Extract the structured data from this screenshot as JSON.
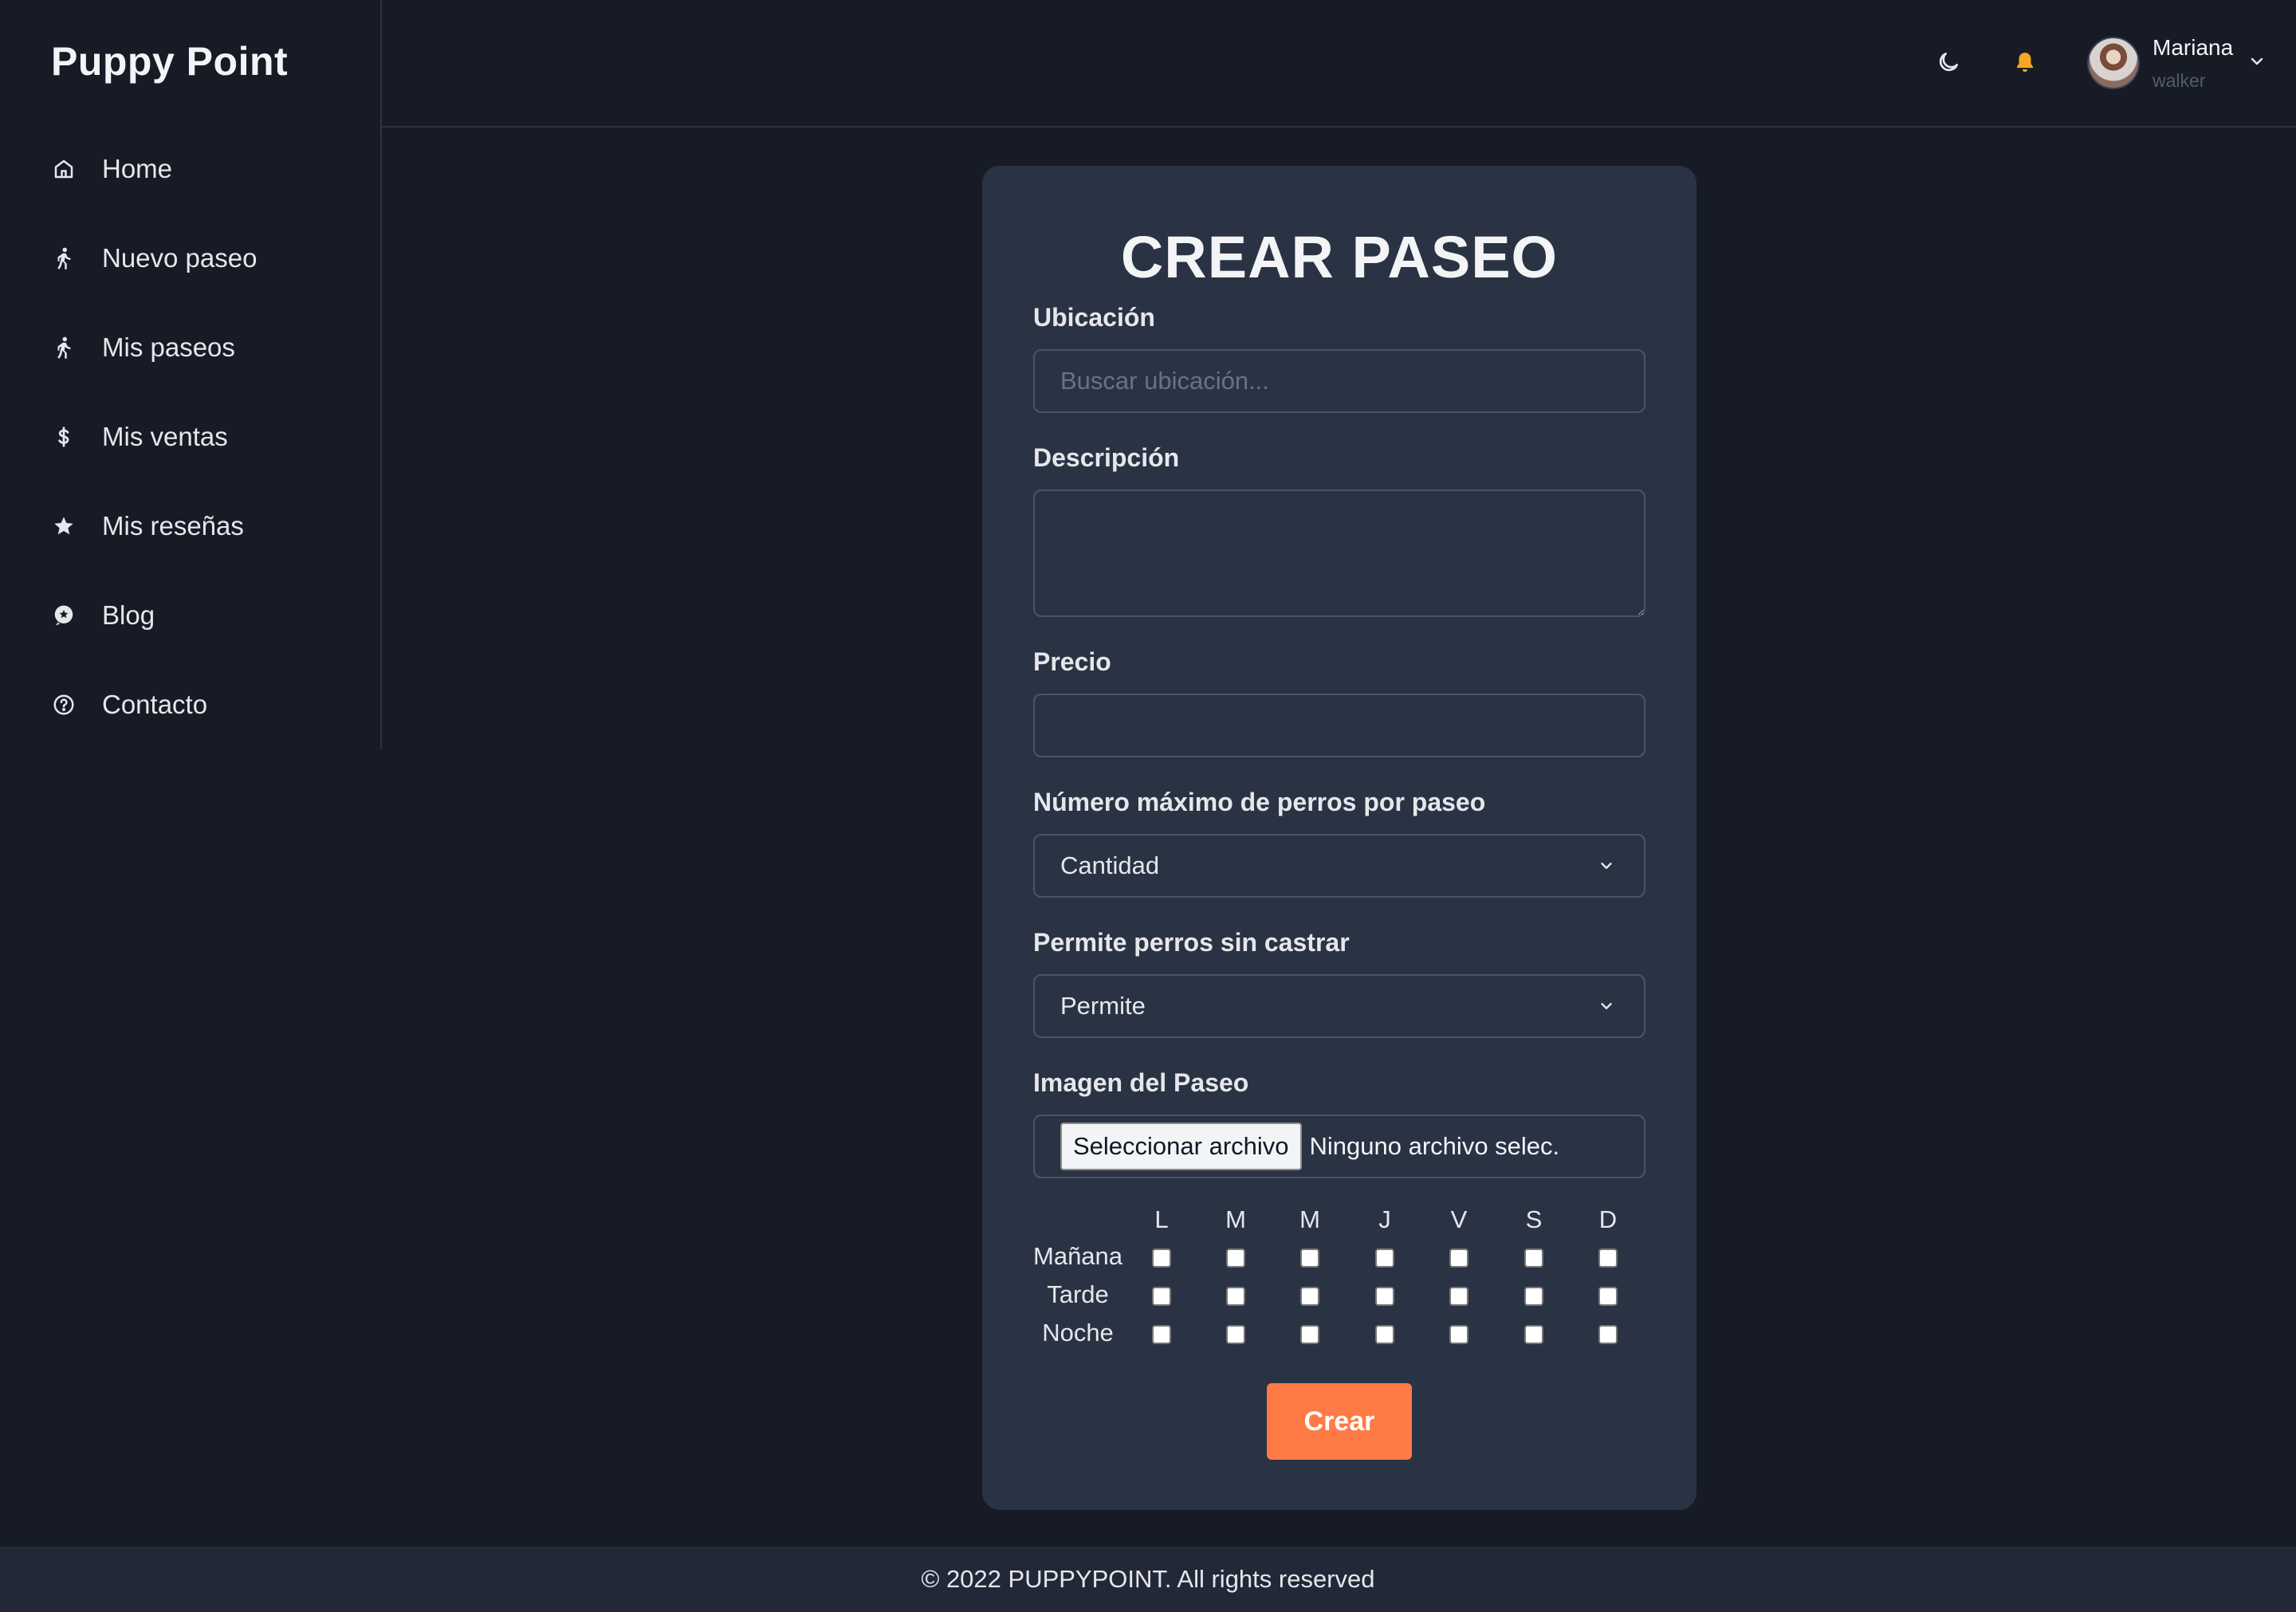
{
  "brand": "Puppy Point",
  "sidebar": {
    "items": [
      {
        "label": "Home",
        "icon": "home-icon"
      },
      {
        "label": "Nuevo paseo",
        "icon": "walking-icon"
      },
      {
        "label": "Mis paseos",
        "icon": "walking-icon"
      },
      {
        "label": "Mis ventas",
        "icon": "dollar-icon"
      },
      {
        "label": "Mis reseñas",
        "icon": "star-icon"
      },
      {
        "label": "Blog",
        "icon": "blog-icon"
      },
      {
        "label": "Contacto",
        "icon": "help-circle-icon"
      }
    ]
  },
  "header": {
    "theme_icon": "moon-icon",
    "notifications_icon": "bell-icon",
    "bell_color": "#f5a623",
    "user": {
      "name": "Mariana",
      "role": "walker"
    }
  },
  "form": {
    "title": "CREAR PASEO",
    "location": {
      "label": "Ubicación",
      "placeholder": "Buscar ubicación...",
      "value": ""
    },
    "description": {
      "label": "Descripción",
      "value": ""
    },
    "price": {
      "label": "Precio",
      "value": ""
    },
    "max_dogs": {
      "label": "Número máximo de perros por paseo",
      "selected": "Cantidad"
    },
    "uncastrated": {
      "label": "Permite perros sin castrar",
      "selected": "Permite"
    },
    "image": {
      "label": "Imagen del Paseo",
      "button": "Seleccionar archivo",
      "status": "Ninguno archivo selec."
    },
    "schedule": {
      "days": [
        "L",
        "M",
        "M",
        "J",
        "V",
        "S",
        "D"
      ],
      "slots": [
        "Mañana",
        "Tarde",
        "Noche"
      ]
    },
    "submit": "Crear"
  },
  "footer": "© 2022 PUPPYPOINT. All rights reserved",
  "colors": {
    "background": "#171b26",
    "card": "#2a3344",
    "accent": "#ff7a45",
    "footer": "#222837"
  }
}
